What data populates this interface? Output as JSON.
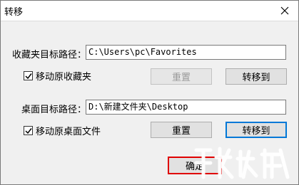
{
  "window": {
    "title": "转移"
  },
  "favorites": {
    "label": "收藏夹目标路径：",
    "path": "C:\\Users\\pc\\Favorites",
    "move_checkbox": {
      "label": "移动原收藏夹",
      "checked": true
    },
    "reset_button": "重置",
    "transfer_button": "转移到"
  },
  "desktop": {
    "label": "桌面目标路径：",
    "path": "D:\\新建文件夹\\Desktop",
    "move_checkbox": {
      "label": "移动原桌面文件",
      "checked": true
    },
    "reset_button": "重置",
    "transfer_button": "转移到"
  },
  "footer": {
    "ok_button": "确定"
  },
  "icons": {
    "close": "close-icon",
    "check": "checkmark-icon",
    "watermark": "watermark-logo"
  }
}
